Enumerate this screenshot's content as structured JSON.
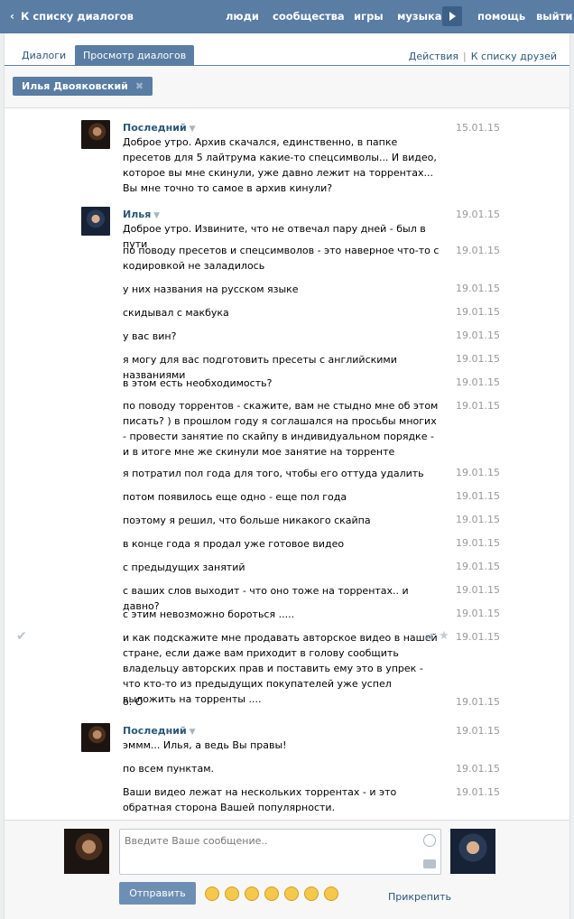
{
  "topbar": {
    "back_label": "К списку диалогов",
    "nav": [
      "люди",
      "сообщества",
      "игры",
      "музыка",
      "помощь",
      "выйти"
    ]
  },
  "tabs": [
    "Диалоги",
    "Просмотр диалогов"
  ],
  "links": {
    "actions": "Действия",
    "separator": "|",
    "friends": "К списку друзей"
  },
  "peer": {
    "name": "Илья Двояковский",
    "remove": "✖"
  },
  "messages": [
    {
      "author": "Последний",
      "text": "Доброе утро. Архив скачался, единственно, в папке пресетов для 5 лайтрума какие-то спецсимволы... И видео, которое вы мне скинули, уже давно лежит на торрентах... Вы мне точно то самое в архив кинули?",
      "date": "15.01.15"
    },
    {
      "author": "Илья",
      "text": "Доброе утро. Извините, что не отвечал пару дней - был в пути",
      "date": "19.01.15"
    },
    {
      "text": "по поводу пресетов и спецсимволов - это наверное что-то с кодировкой не заладилось",
      "date": "19.01.15"
    },
    {
      "text": "у них названия на русском языке",
      "date": "19.01.15"
    },
    {
      "text": "скидывал с макбука",
      "date": "19.01.15"
    },
    {
      "text": "у вас вин?",
      "date": "19.01.15"
    },
    {
      "text": "я могу для вас подготовить пресеты с английскими названиями",
      "date": "19.01.15"
    },
    {
      "text": "в этом есть необходимость?",
      "date": "19.01.15"
    },
    {
      "text": "по поводу торрентов - скажите, вам не стыдно мне об этом писать? ) в прошлом году я соглашался на просьбы многих - провести занятие по скайпу в индивидуальном порядке - и в итоге мне же скинули мое занятие на торренте",
      "date": "19.01.15"
    },
    {
      "text": "я потратил пол года для того, чтобы его оттуда удалить",
      "date": "19.01.15"
    },
    {
      "text": "потом появилось еще одно - еще пол года",
      "date": "19.01.15"
    },
    {
      "text": "поэтому я решил, что больше никакого скайпа",
      "date": "19.01.15"
    },
    {
      "text": "в конце года я продал уже готовое видео",
      "date": "19.01.15"
    },
    {
      "text": "с предыдущих занятий",
      "date": "19.01.15"
    },
    {
      "text": "с ваших слов выходит - что оно тоже на торрентах.. и давно?",
      "date": "19.01.15"
    },
    {
      "text": "с этим невозможно бороться .....",
      "date": "19.01.15"
    },
    {
      "text": "и как подскажите мне продавать авторское видео в нашей стране, если даже вам приходит в голову сообщить владельцу авторских прав и поставить ему это в упрек - что кто-то из предыдущих покупателей уже успел выложить на торренты ....",
      "date": "19.01.15"
    },
    {
      "text": "о. О",
      "date": "19.01.15"
    },
    {
      "author": "Последний",
      "text": "эммм... Илья, а ведь Вы правы!",
      "date": "19.01.15"
    },
    {
      "text": "по всем пунктам.",
      "date": "19.01.15"
    },
    {
      "text": "Ваши видео лежат на нескольких торрентах - и это обратная сторона Вашей популярности.",
      "date": "19.01.15"
    }
  ],
  "compose": {
    "placeholder": "Введите Ваше сообщение..",
    "send_label": "Отправить",
    "attach_label": "Прикрепить"
  },
  "colors": {
    "header": "#597da3",
    "link": "#2b587a",
    "date": "#999999"
  }
}
